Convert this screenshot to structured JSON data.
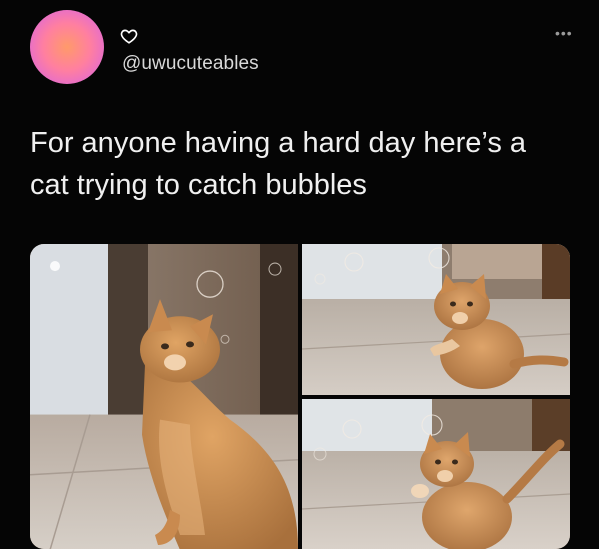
{
  "profile": {
    "handle": "@uwucuteables",
    "avatar_colors": [
      "#ff9a6a",
      "#ff7fa0",
      "#c86be0"
    ],
    "badge_icon": "heart-icon"
  },
  "post": {
    "text": "For anyone having a hard day here’s a cat trying to catch bubbles",
    "more_icon": "more-dots-icon",
    "images": [
      {
        "subject": "cat-looking-up-at-bubbles"
      },
      {
        "subject": "cat-reaching-for-bubble"
      },
      {
        "subject": "cat-batting-bubble"
      }
    ]
  },
  "colors": {
    "background": "#050505",
    "text": "#f0f0f0",
    "cat_fur": "#c88a4e"
  }
}
